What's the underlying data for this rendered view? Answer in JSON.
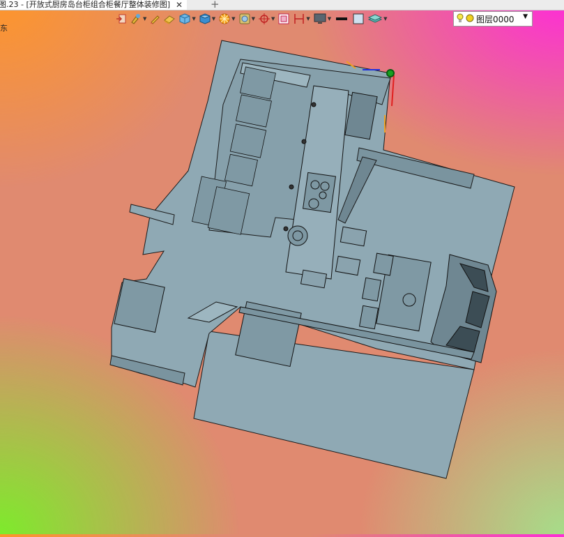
{
  "tab": {
    "title": "图.23 - [开放式厨房岛台柜组合柜餐厅整体装修图]",
    "close": "✕",
    "add": "+"
  },
  "side_fragment": "东",
  "layer": {
    "name": "图层0000"
  },
  "colors": {
    "model_fill": "#8fa9b4",
    "model_dark": "#6f8792",
    "edge": "#1a1a1a",
    "axis_red": "#e02020",
    "axis_green": "#18a020",
    "axis_blue": "#2030e0",
    "axis_orange": "#f0a020"
  },
  "icons": [
    "exit-icon",
    "brush-icon",
    "pencil-icon",
    "eraser-icon",
    "cube-icon",
    "solid-cube-icon",
    "render-icon",
    "texture-icon",
    "snap-icon",
    "rect-icon",
    "dimension-icon",
    "monitor-icon",
    "line-weight-icon",
    "color-swatch-icon",
    "layer-stack-icon",
    "bulb-icon",
    "layer-dot-icon"
  ]
}
